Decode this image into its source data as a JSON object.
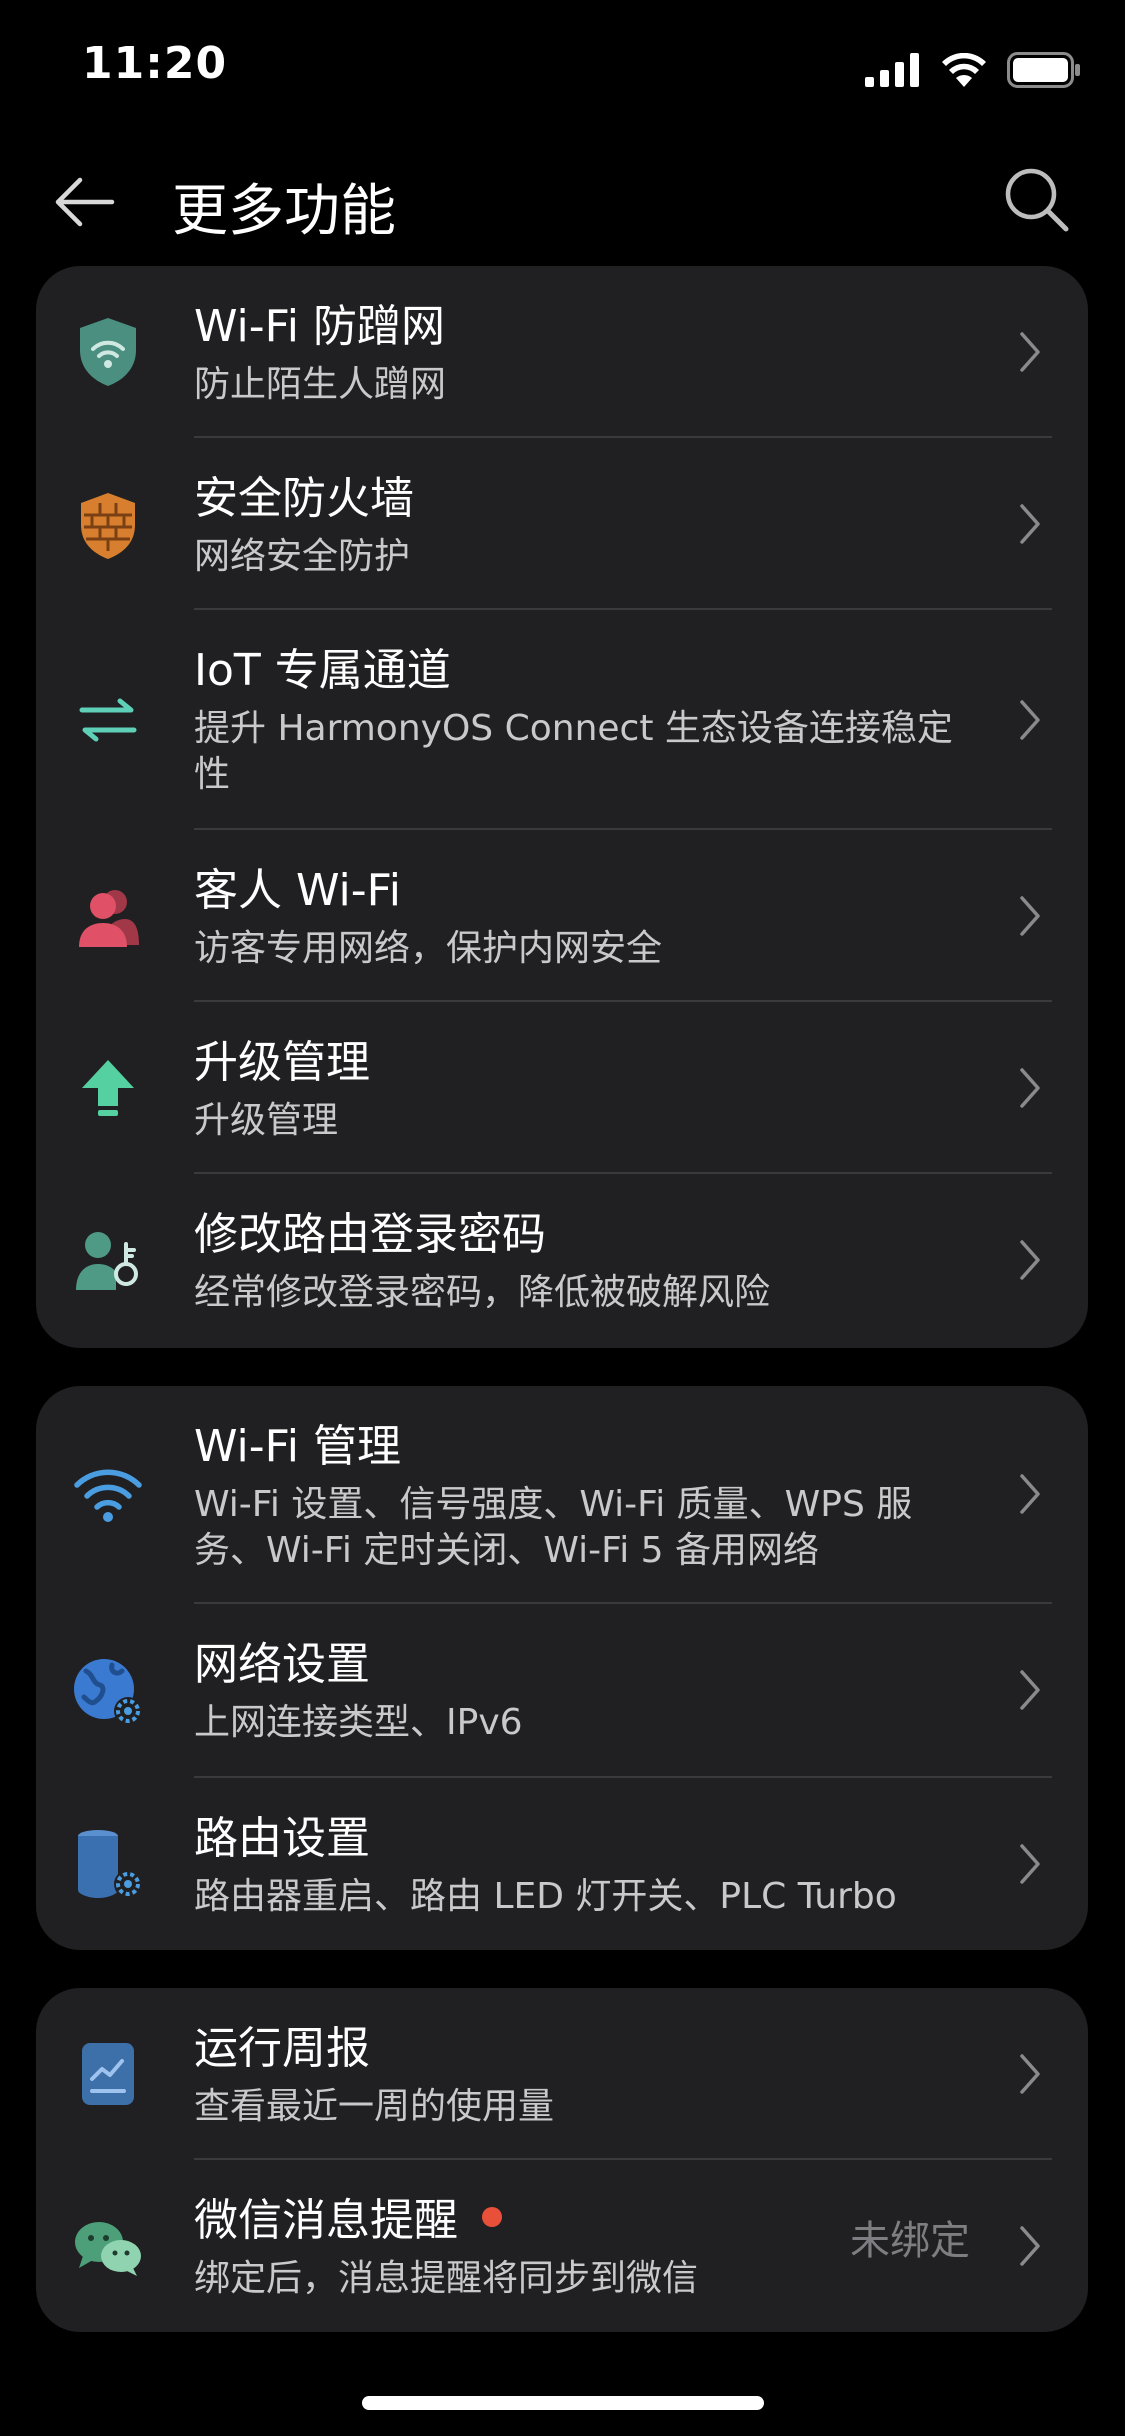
{
  "status_bar": {
    "time": "11:20"
  },
  "header": {
    "title": "更多功能"
  },
  "group1": [
    {
      "title": "Wi-Fi 防蹭网",
      "subtitle": "防止陌生人蹭网",
      "icon": "shield-wifi-icon"
    },
    {
      "title": "安全防火墙",
      "subtitle": "网络安全防护",
      "icon": "firewall-icon"
    },
    {
      "title": "IoT 专属通道",
      "subtitle": "提升 HarmonyOS Connect 生态设备连接稳定性",
      "icon": "arrows-exchange-icon"
    },
    {
      "title": "客人 Wi-Fi",
      "subtitle": "访客专用网络，保护内网安全",
      "icon": "guests-icon"
    },
    {
      "title": "升级管理",
      "subtitle": "升级管理",
      "icon": "upgrade-arrow-icon"
    },
    {
      "title": "修改路由登录密码",
      "subtitle": "经常修改登录密码，降低被破解风险",
      "icon": "user-key-icon"
    }
  ],
  "group2": [
    {
      "title": "Wi-Fi 管理",
      "subtitle": "Wi-Fi 设置、信号强度、Wi-Fi 质量、WPS 服务、Wi-Fi 定时关闭、Wi-Fi 5 备用网络",
      "icon": "wifi-icon"
    },
    {
      "title": "网络设置",
      "subtitle": "上网连接类型、IPv6",
      "icon": "globe-gear-icon"
    },
    {
      "title": "路由设置",
      "subtitle": "路由器重启、路由 LED 灯开关、PLC Turbo",
      "icon": "router-gear-icon"
    }
  ],
  "group3": [
    {
      "title": "运行周报",
      "subtitle": "查看最近一周的使用量",
      "icon": "report-chart-icon"
    },
    {
      "title": "微信消息提醒",
      "subtitle": "绑定后，消息提醒将同步到微信",
      "icon": "wechat-icon",
      "value": "未绑定"
    }
  ],
  "colors": {
    "background": "#000000",
    "card": "#202022",
    "shield": "#4a8f80",
    "firewall": "#d77f2e",
    "iot": "#5fd0b8",
    "guest": "#e05066",
    "upgrade": "#55d0a0",
    "key": "#4e9a85",
    "wifi": "#4a9de0",
    "globe": "#3a7ad0",
    "router": "#3a6fb0",
    "report": "#3d6fa8",
    "wechat": "#4d9f7a",
    "badge": "#e8503a"
  }
}
